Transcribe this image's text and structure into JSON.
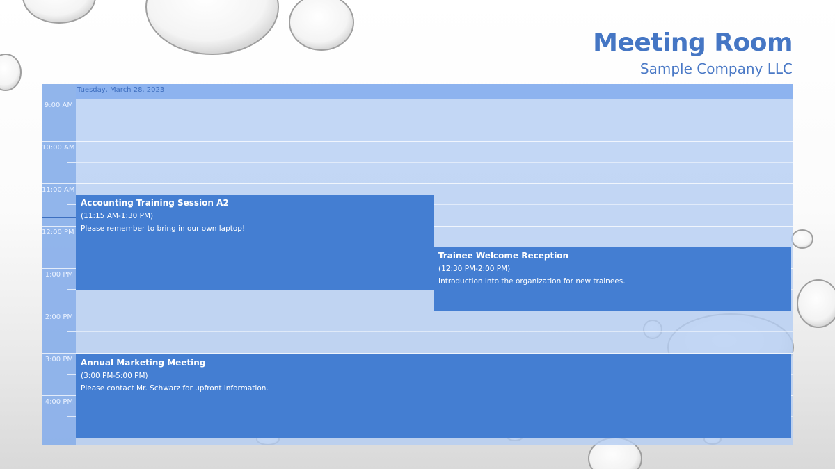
{
  "header": {
    "title": "Meeting Room",
    "subtitle": "Sample Company LLC"
  },
  "scheduler": {
    "date_label": "Tuesday, March 28, 2023",
    "time_slots": [
      "9:00 AM",
      "10:00 AM",
      "11:00 AM",
      "12:00 PM",
      "1:00 PM",
      "2:00 PM",
      "3:00 PM",
      "4:00 PM"
    ],
    "appointments": [
      {
        "title": "Accounting Training Session A2",
        "time": "(11:15 AM-1:30 PM)",
        "description": "Please remember to bring in our own laptop!"
      },
      {
        "title": "Trainee Welcome Reception",
        "time": "(12:30 PM-2:00 PM)",
        "description": "Introduction into the organization for new trainees."
      },
      {
        "title": "Annual Marketing Meeting",
        "time": "(3:00 PM-5:00 PM)",
        "description": "Please contact Mr. Schwarz for upfront information."
      }
    ]
  },
  "colors": {
    "accent": "#4576c4",
    "appointment": "#447ed2",
    "day_header": "#8db3ef"
  }
}
